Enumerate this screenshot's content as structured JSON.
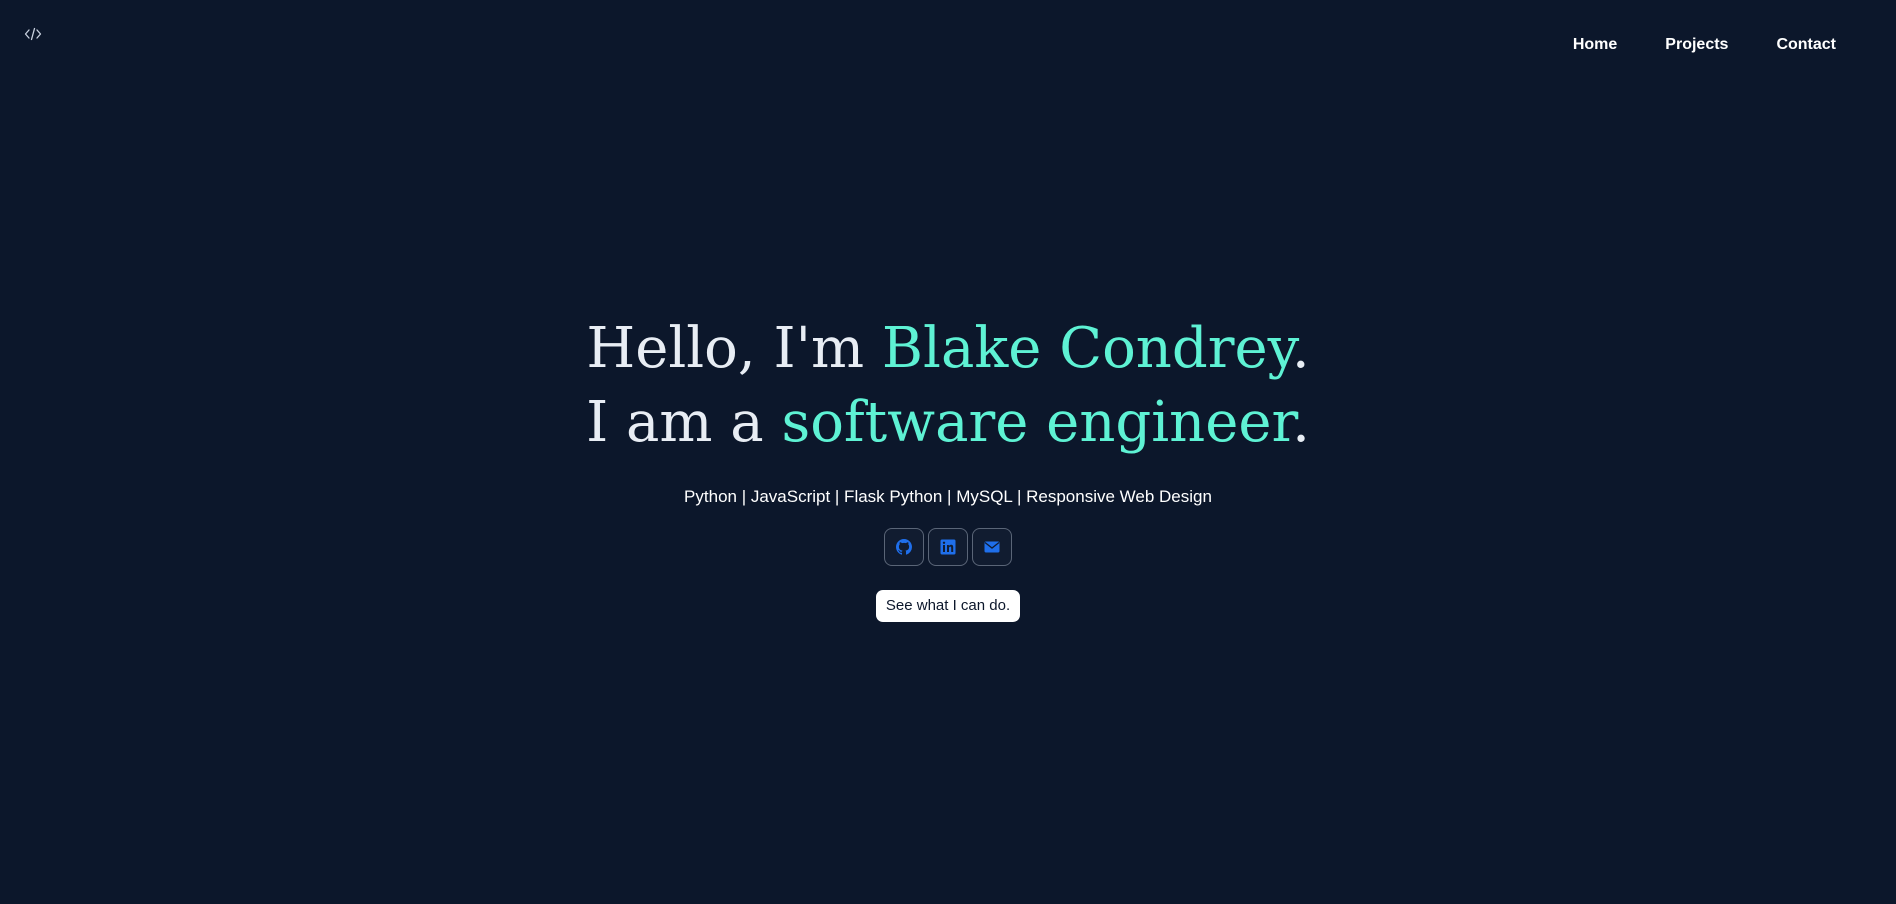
{
  "header": {
    "logo_icon": "code-icon",
    "nav": [
      {
        "label": "Home"
      },
      {
        "label": "Projects"
      },
      {
        "label": "Contact"
      }
    ]
  },
  "hero": {
    "line1_prefix": "Hello, I'm ",
    "line1_name": "Blake Condrey",
    "line1_suffix": ".",
    "line2_prefix": "I am a ",
    "line2_role": "software engineer",
    "line2_suffix": ".",
    "skills": "Python | JavaScript | Flask Python | MySQL | Responsive Web Design",
    "socials": [
      {
        "icon": "github-icon"
      },
      {
        "icon": "linkedin-icon"
      },
      {
        "icon": "email-icon"
      }
    ],
    "cta_label": "See what I can do."
  },
  "colors": {
    "background": "#0c172b",
    "accent": "#5ef2d4",
    "icon_blue": "#1f6feb",
    "text": "#e8edf4"
  }
}
